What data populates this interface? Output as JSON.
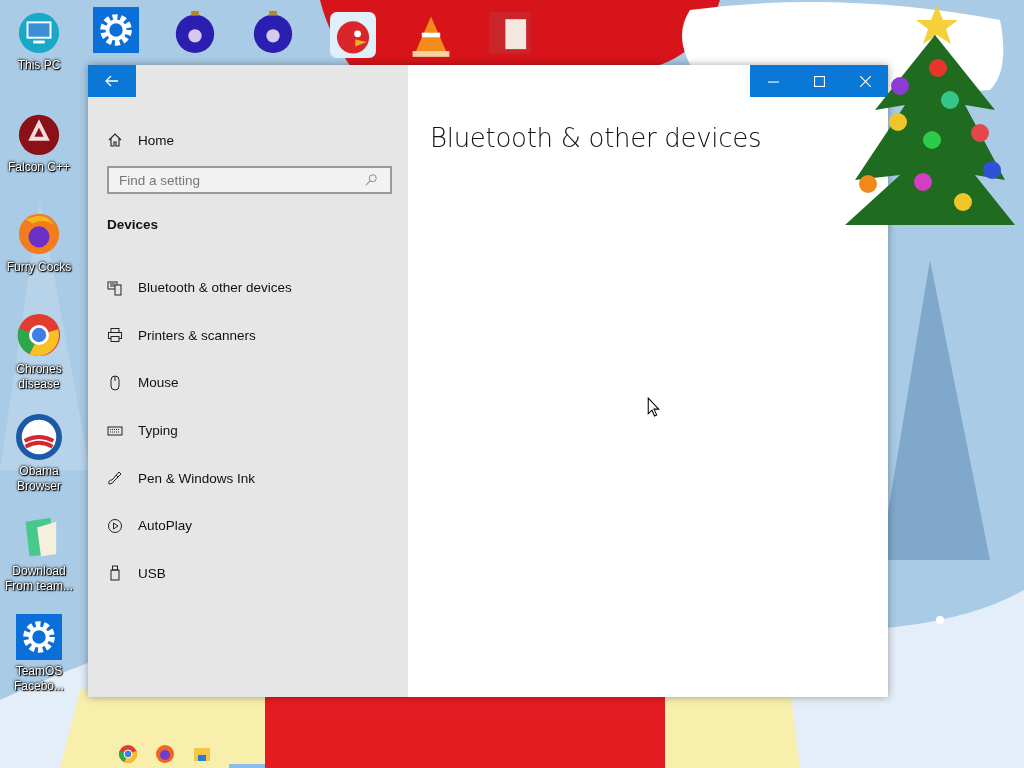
{
  "desktop": {
    "icons": [
      {
        "label": "This PC"
      },
      {
        "label": "Falcon C++"
      },
      {
        "label": "Furry Cocks"
      },
      {
        "label": "Chrones disease"
      },
      {
        "label": "Obama Browser"
      },
      {
        "label": "Download From team..."
      },
      {
        "label": "TeamOS Facebo..."
      }
    ]
  },
  "settings_window": {
    "sidebar": {
      "home": "Home",
      "search": {
        "placeholder": "Find a setting"
      },
      "section": "Devices",
      "items": [
        {
          "label": "Bluetooth & other devices"
        },
        {
          "label": "Printers & scanners"
        },
        {
          "label": "Mouse"
        },
        {
          "label": "Typing"
        },
        {
          "label": "Pen & Windows Ink"
        },
        {
          "label": "AutoPlay"
        },
        {
          "label": "USB"
        }
      ]
    },
    "page_title": "Bluetooth & other devices"
  }
}
